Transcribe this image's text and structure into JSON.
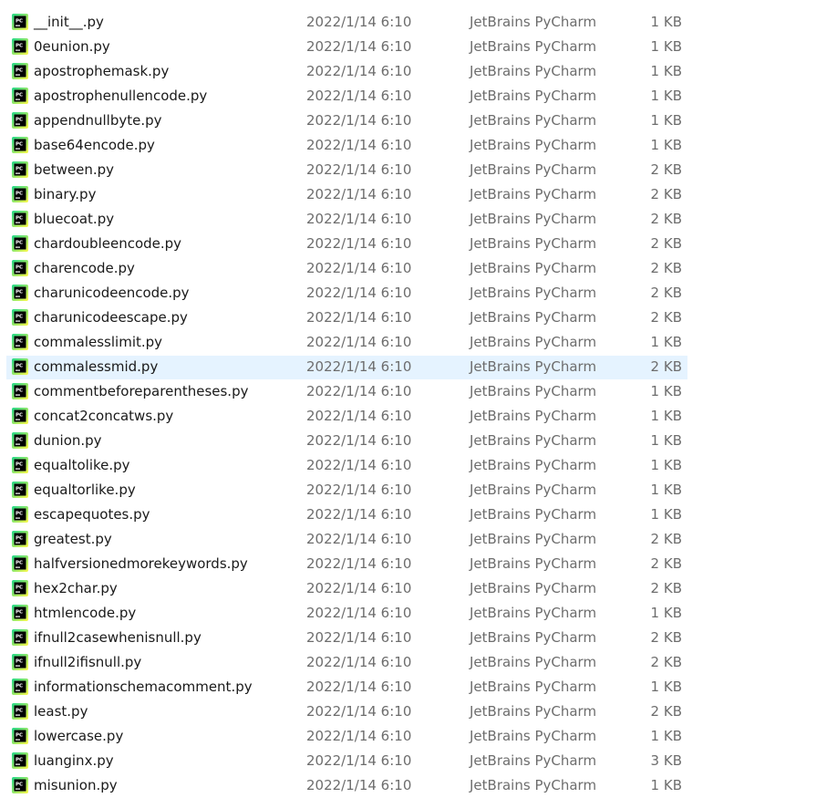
{
  "files": [
    {
      "name": "__init__.py",
      "date": "2022/1/14 6:10",
      "type": "JetBrains PyCharm",
      "size": "1 KB"
    },
    {
      "name": "0eunion.py",
      "date": "2022/1/14 6:10",
      "type": "JetBrains PyCharm",
      "size": "1 KB"
    },
    {
      "name": "apostrophemask.py",
      "date": "2022/1/14 6:10",
      "type": "JetBrains PyCharm",
      "size": "1 KB"
    },
    {
      "name": "apostrophenullencode.py",
      "date": "2022/1/14 6:10",
      "type": "JetBrains PyCharm",
      "size": "1 KB"
    },
    {
      "name": "appendnullbyte.py",
      "date": "2022/1/14 6:10",
      "type": "JetBrains PyCharm",
      "size": "1 KB"
    },
    {
      "name": "base64encode.py",
      "date": "2022/1/14 6:10",
      "type": "JetBrains PyCharm",
      "size": "1 KB"
    },
    {
      "name": "between.py",
      "date": "2022/1/14 6:10",
      "type": "JetBrains PyCharm",
      "size": "2 KB"
    },
    {
      "name": "binary.py",
      "date": "2022/1/14 6:10",
      "type": "JetBrains PyCharm",
      "size": "2 KB"
    },
    {
      "name": "bluecoat.py",
      "date": "2022/1/14 6:10",
      "type": "JetBrains PyCharm",
      "size": "2 KB"
    },
    {
      "name": "chardoubleencode.py",
      "date": "2022/1/14 6:10",
      "type": "JetBrains PyCharm",
      "size": "2 KB"
    },
    {
      "name": "charencode.py",
      "date": "2022/1/14 6:10",
      "type": "JetBrains PyCharm",
      "size": "2 KB"
    },
    {
      "name": "charunicodeencode.py",
      "date": "2022/1/14 6:10",
      "type": "JetBrains PyCharm",
      "size": "2 KB"
    },
    {
      "name": "charunicodeescape.py",
      "date": "2022/1/14 6:10",
      "type": "JetBrains PyCharm",
      "size": "2 KB"
    },
    {
      "name": "commalesslimit.py",
      "date": "2022/1/14 6:10",
      "type": "JetBrains PyCharm",
      "size": "1 KB"
    },
    {
      "name": "commalessmid.py",
      "date": "2022/1/14 6:10",
      "type": "JetBrains PyCharm",
      "size": "2 KB",
      "selected": true
    },
    {
      "name": "commentbeforeparentheses.py",
      "date": "2022/1/14 6:10",
      "type": "JetBrains PyCharm",
      "size": "1 KB"
    },
    {
      "name": "concat2concatws.py",
      "date": "2022/1/14 6:10",
      "type": "JetBrains PyCharm",
      "size": "1 KB"
    },
    {
      "name": "dunion.py",
      "date": "2022/1/14 6:10",
      "type": "JetBrains PyCharm",
      "size": "1 KB"
    },
    {
      "name": "equaltolike.py",
      "date": "2022/1/14 6:10",
      "type": "JetBrains PyCharm",
      "size": "1 KB"
    },
    {
      "name": "equaltorlike.py",
      "date": "2022/1/14 6:10",
      "type": "JetBrains PyCharm",
      "size": "1 KB"
    },
    {
      "name": "escapequotes.py",
      "date": "2022/1/14 6:10",
      "type": "JetBrains PyCharm",
      "size": "1 KB"
    },
    {
      "name": "greatest.py",
      "date": "2022/1/14 6:10",
      "type": "JetBrains PyCharm",
      "size": "2 KB"
    },
    {
      "name": "halfversionedmorekeywords.py",
      "date": "2022/1/14 6:10",
      "type": "JetBrains PyCharm",
      "size": "2 KB"
    },
    {
      "name": "hex2char.py",
      "date": "2022/1/14 6:10",
      "type": "JetBrains PyCharm",
      "size": "2 KB"
    },
    {
      "name": "htmlencode.py",
      "date": "2022/1/14 6:10",
      "type": "JetBrains PyCharm",
      "size": "1 KB"
    },
    {
      "name": "ifnull2casewhenisnull.py",
      "date": "2022/1/14 6:10",
      "type": "JetBrains PyCharm",
      "size": "2 KB"
    },
    {
      "name": "ifnull2ifisnull.py",
      "date": "2022/1/14 6:10",
      "type": "JetBrains PyCharm",
      "size": "2 KB"
    },
    {
      "name": "informationschemacomment.py",
      "date": "2022/1/14 6:10",
      "type": "JetBrains PyCharm",
      "size": "1 KB"
    },
    {
      "name": "least.py",
      "date": "2022/1/14 6:10",
      "type": "JetBrains PyCharm",
      "size": "2 KB"
    },
    {
      "name": "lowercase.py",
      "date": "2022/1/14 6:10",
      "type": "JetBrains PyCharm",
      "size": "1 KB"
    },
    {
      "name": "luanginx.py",
      "date": "2022/1/14 6:10",
      "type": "JetBrains PyCharm",
      "size": "3 KB"
    },
    {
      "name": "misunion.py",
      "date": "2022/1/14 6:10",
      "type": "JetBrains PyCharm",
      "size": "1 KB"
    }
  ],
  "icon": "pycharm-file-icon",
  "colors": {
    "selected_row": "#e5f3ff",
    "name_text": "#1a1a1a",
    "meta_text": "#6d6d6d"
  }
}
